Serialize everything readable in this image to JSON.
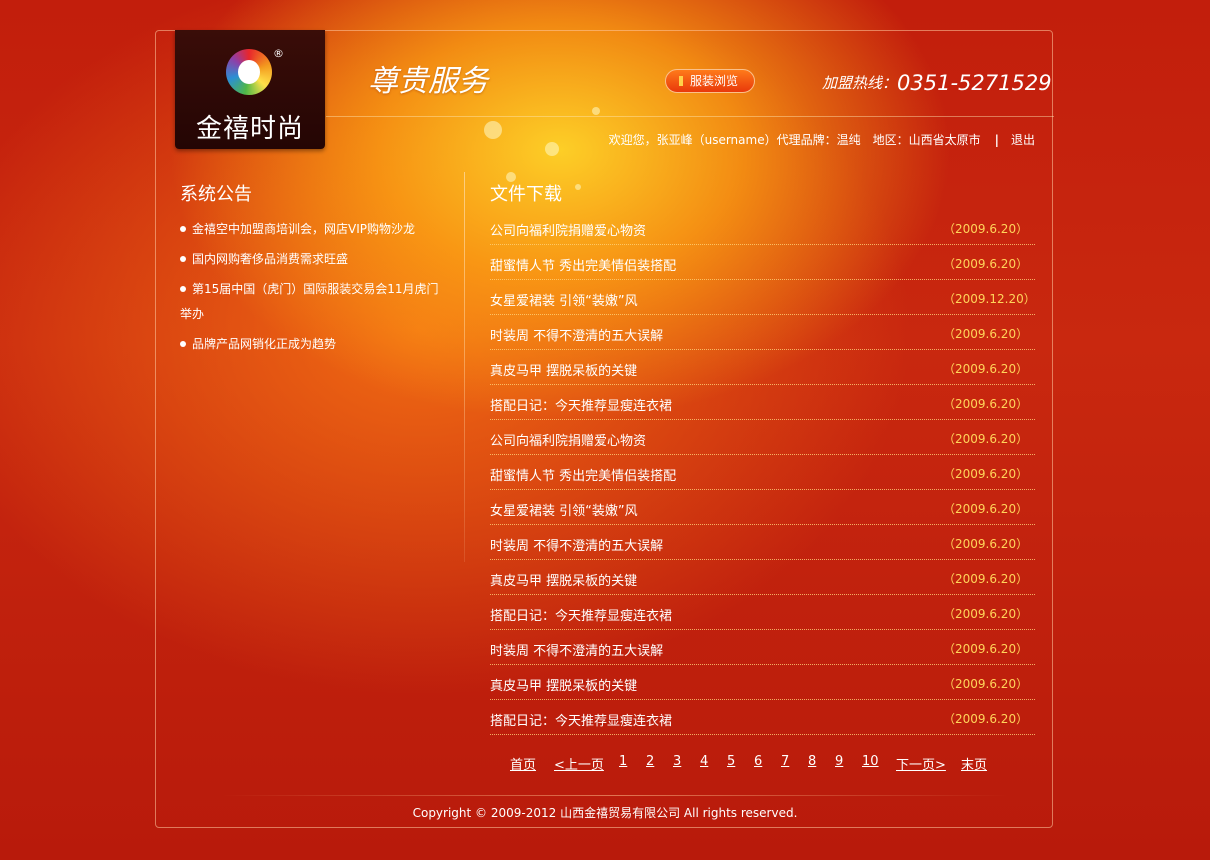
{
  "header": {
    "logo_text": "金禧时尚",
    "logo_reg": "®",
    "service_title": "尊贵服务",
    "browse_button": "服装浏览",
    "hotline_label": "加盟热线：",
    "hotline_number": "0351-5271529"
  },
  "welcome": {
    "text": "欢迎您，张亚峰（username）代理品牌：温纯　地区：山西省太原市",
    "separator": "|",
    "logout": "退出"
  },
  "notices": {
    "title": "系统公告",
    "items": [
      "金禧空中加盟商培训会，网店VIP购物沙龙",
      "国内网购奢侈品消费需求旺盛",
      "第15届中国（虎门）国际服装交易会11月虎门举办",
      "品牌产品网销化正成为趋势"
    ]
  },
  "downloads": {
    "title": "文件下载",
    "items": [
      {
        "title": "公司向福利院捐赠爱心物资",
        "date": "（2009.6.20）"
      },
      {
        "title": "甜蜜情人节 秀出完美情侣装搭配",
        "date": "（2009.6.20）"
      },
      {
        "title": "女星爱裙装 引领“装嫩”风",
        "date": "（2009.12.20）"
      },
      {
        "title": "时装周 不得不澄清的五大误解",
        "date": "（2009.6.20）"
      },
      {
        "title": "真皮马甲 摆脱呆板的关键",
        "date": "（2009.6.20）"
      },
      {
        "title": "搭配日记：今天推荐显瘦连衣裙",
        "date": "（2009.6.20）"
      },
      {
        "title": "公司向福利院捐赠爱心物资",
        "date": "（2009.6.20）"
      },
      {
        "title": "甜蜜情人节 秀出完美情侣装搭配",
        "date": "（2009.6.20）"
      },
      {
        "title": "女星爱裙装 引领“装嫩”风",
        "date": "（2009.6.20）"
      },
      {
        "title": "时装周 不得不澄清的五大误解",
        "date": "（2009.6.20）"
      },
      {
        "title": "真皮马甲 摆脱呆板的关键",
        "date": "（2009.6.20）"
      },
      {
        "title": "搭配日记：今天推荐显瘦连衣裙",
        "date": "（2009.6.20）"
      },
      {
        "title": "时装周 不得不澄清的五大误解",
        "date": "（2009.6.20）"
      },
      {
        "title": "真皮马甲 摆脱呆板的关键",
        "date": "（2009.6.20）"
      },
      {
        "title": "搭配日记：今天推荐显瘦连衣裙",
        "date": "（2009.6.20）"
      }
    ]
  },
  "pager": {
    "first": "首页",
    "prev": "<上一页",
    "pages": [
      "1",
      "2",
      "3",
      "4",
      "5",
      "6",
      "7",
      "8",
      "9",
      "10"
    ],
    "next": "下一页>",
    "last": "末页"
  },
  "footer": {
    "copyright": "Copyright © 2009-2012 山西金禧贸易有限公司 All rights reserved."
  },
  "colors": {
    "accent": "#ffd45a",
    "background_red": "#c21e0c",
    "highlight_yellow": "#ffd628"
  }
}
